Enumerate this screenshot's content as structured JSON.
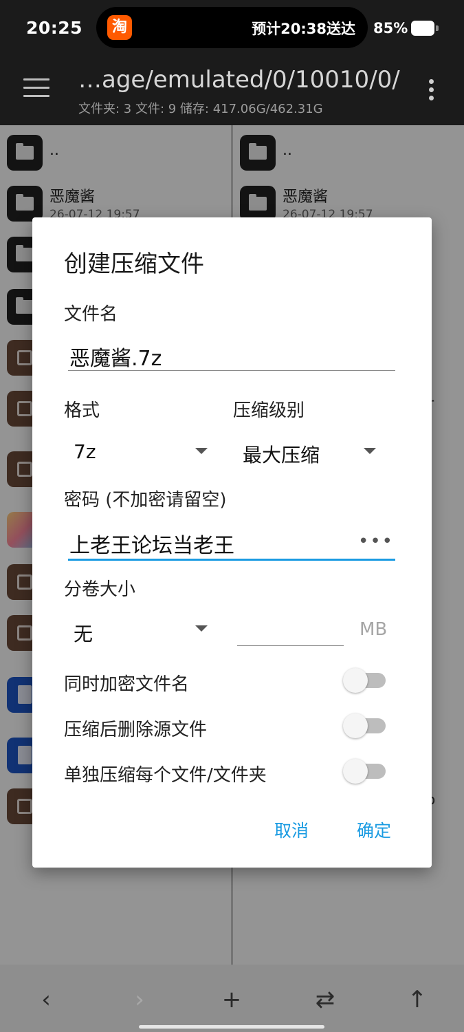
{
  "status_bar": {
    "time": "20:25",
    "island_app": "淘",
    "island_text": "预计20:38送达",
    "battery": "85%"
  },
  "app_bar": {
    "path": "…age/emulated/0/10010/0/",
    "info": "文件夹: 3  文件: 9  储存: 417.06G/462.31G"
  },
  "panes": {
    "left": {
      "parent": "..",
      "first_name": "恶魔酱",
      "first_date": "26-07-12 19:57"
    },
    "right": {
      "parent": "..",
      "first_name": "恶魔酱",
      "first_date": "26-07-12 19:57",
      "edge_1": "r",
      "edge_2": "o"
    }
  },
  "dialog": {
    "title": "创建压缩文件",
    "filename_label": "文件名",
    "filename_value": "恶魔酱.7z",
    "format_label": "格式",
    "format_value": "7z",
    "level_label": "压缩级别",
    "level_value": "最大压缩",
    "password_label": "密码 (不加密请留空)",
    "password_value": "上老王论坛当老王",
    "password_toggle": "•••",
    "split_label": "分卷大小",
    "split_value": "无",
    "split_size_value": "",
    "split_unit": "MB",
    "toggles": [
      {
        "label": "同时加密文件名",
        "on": false
      },
      {
        "label": "压缩后删除源文件",
        "on": false
      },
      {
        "label": "单独压缩每个文件/文件夹",
        "on": false
      }
    ],
    "cancel": "取消",
    "ok": "确定",
    "accent_color": "#1a9be2"
  },
  "bottom_nav": {
    "back": "‹",
    "forward": "›",
    "add": "+",
    "swap": "⇄",
    "up": "↑"
  }
}
